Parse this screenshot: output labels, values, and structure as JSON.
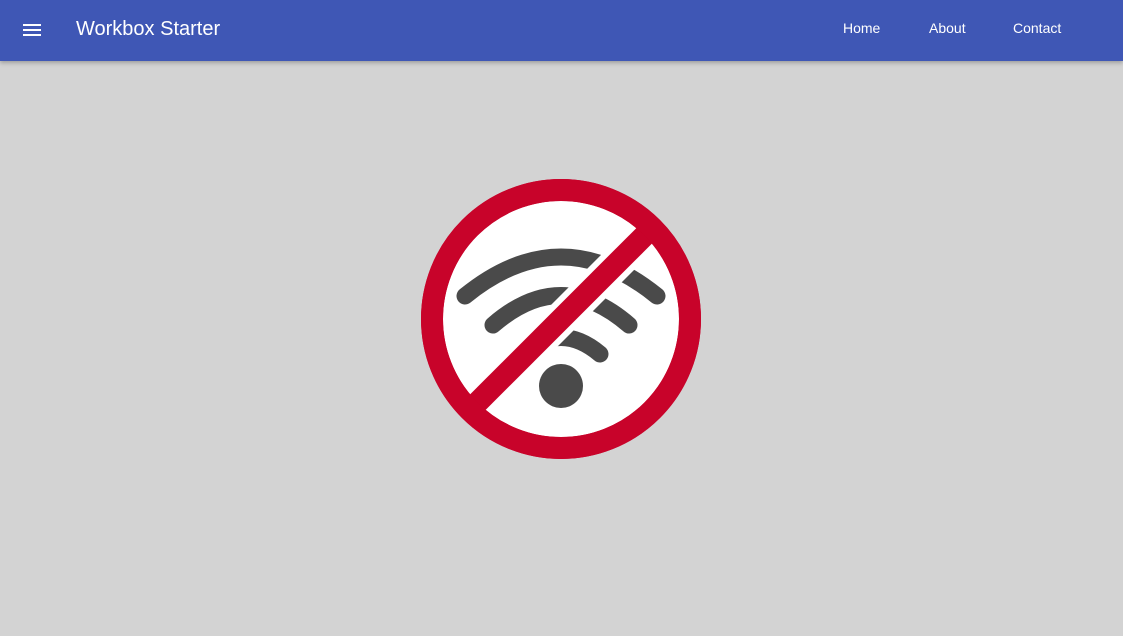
{
  "header": {
    "menu_icon": "hamburger-menu-icon",
    "title": "Workbox Starter",
    "background_color": "#3f57b5",
    "nav": [
      {
        "label": "Home"
      },
      {
        "label": "About"
      },
      {
        "label": "Contact"
      }
    ]
  },
  "main": {
    "background_color": "#d3d3d3",
    "illustration": {
      "icon": "no-wifi-icon",
      "ring_color": "#c8032a",
      "wifi_color": "#4a4a4a"
    }
  }
}
